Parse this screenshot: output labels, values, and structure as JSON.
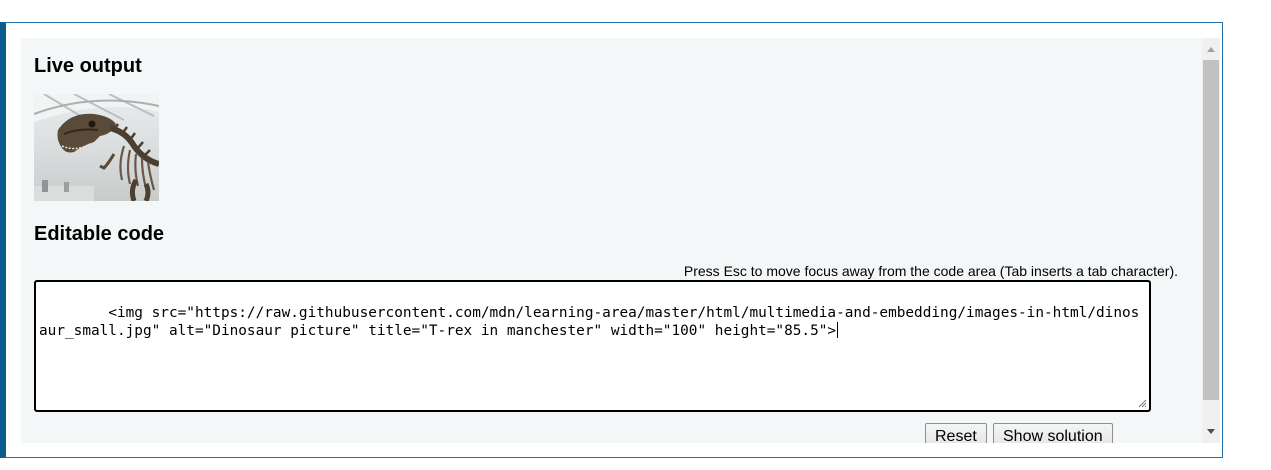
{
  "live_output": {
    "heading": "Live output",
    "image_alt": "Dinosaur picture",
    "image_title": "T-rex in manchester"
  },
  "editable_code": {
    "heading": "Editable code",
    "hint": "Press Esc to move focus away from the code area (Tab inserts a tab character).",
    "code": "<img src=\"https://raw.githubusercontent.com/mdn/learning-area/master/html/multimedia-and-embedding/images-in-html/dinosaur_small.jpg\" alt=\"Dinosaur picture\" title=\"T-rex in manchester\" width=\"100\" height=\"85.5\">"
  },
  "buttons": {
    "reset": "Reset",
    "show_solution": "Show solution"
  },
  "colors": {
    "frame_border": "#0b5b8f",
    "panel_background": "#f4f7f8",
    "scrollbar_thumb": "#c1c1c1"
  },
  "icons": {
    "scroll_up": "triangle-up-icon",
    "scroll_down": "triangle-down-icon",
    "resize": "resize-grip-icon"
  }
}
